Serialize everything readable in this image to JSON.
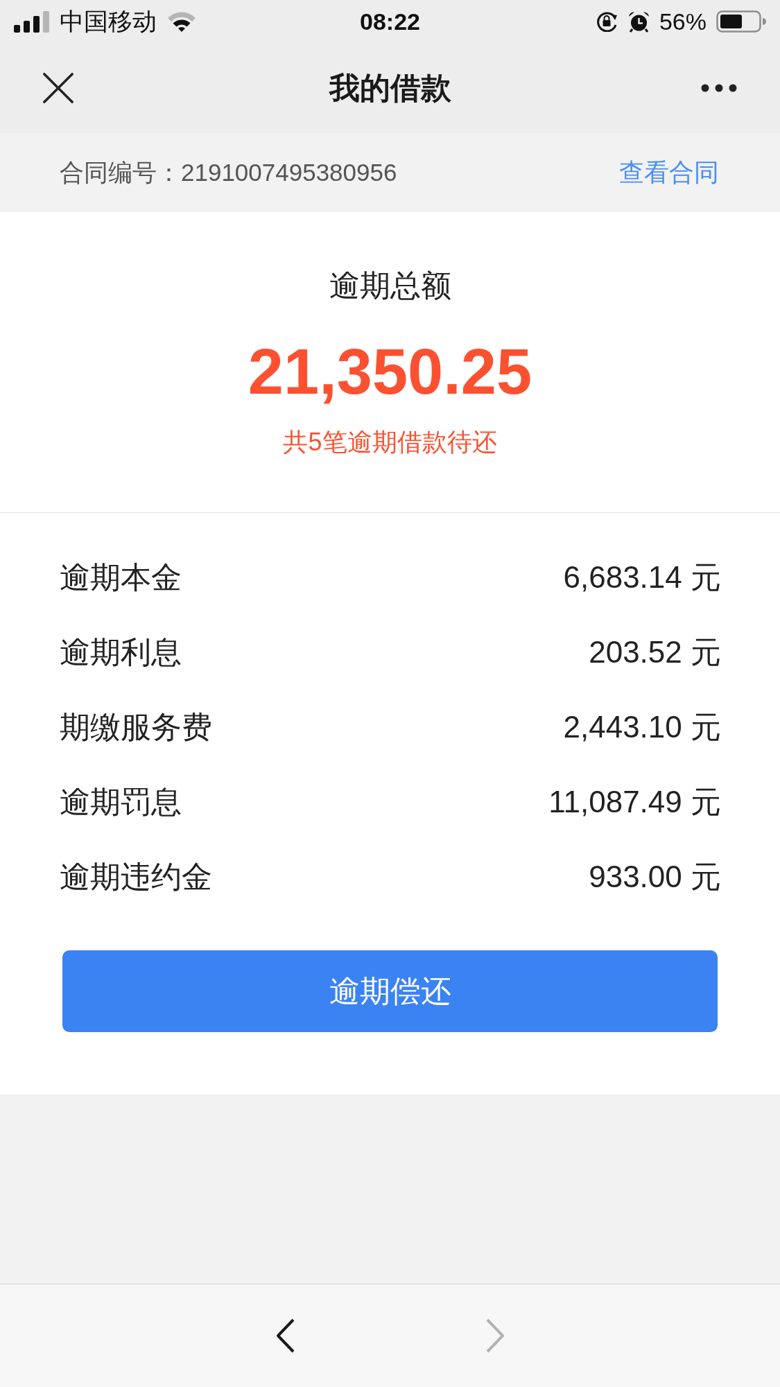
{
  "status_bar": {
    "carrier": "中国移动",
    "time": "08:22",
    "battery": "56%"
  },
  "nav_bar": {
    "title": "我的借款"
  },
  "contract": {
    "number": "合同编号：2191007495380956",
    "link": "查看合同"
  },
  "summary": {
    "title": "逾期总额",
    "amount": "21,350.25",
    "note": "共5笔逾期借款待还"
  },
  "breakdown": [
    {
      "label": "逾期本金",
      "amount": "6,683.14 元"
    },
    {
      "label": "逾期利息",
      "amount": "203.52 元"
    },
    {
      "label": "期缴服务费",
      "amount": "2,443.10 元"
    },
    {
      "label": "逾期罚息",
      "amount": "11,087.49 元"
    },
    {
      "label": "逾期违约金",
      "amount": "933.00 元"
    }
  ],
  "repay_button": {
    "label": "逾期偿还"
  },
  "bottom_toolbar": {
    "back": {
      "disabled": false
    },
    "forward": {
      "disabled": true
    }
  }
}
